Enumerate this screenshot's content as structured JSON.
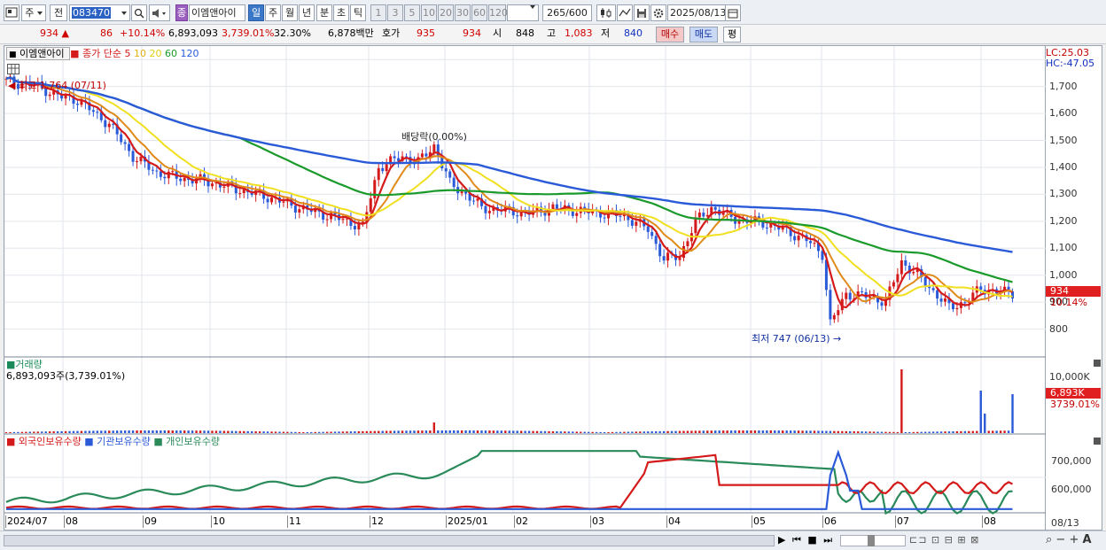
{
  "toolbar": {
    "period_label": "주",
    "prev_label": "전",
    "code": "083470",
    "badge": "종",
    "stock_name": "이엠앤아이",
    "periods": [
      "일",
      "주",
      "월",
      "년",
      "분",
      "초",
      "틱"
    ],
    "active_period": "일",
    "intervals": [
      "1",
      "3",
      "5",
      "10",
      "20",
      "30",
      "60",
      "120"
    ],
    "count": "265",
    "count_total": "/600",
    "date": "2025/08/13"
  },
  "quote": {
    "price": "934",
    "change": "86",
    "change_pct": "+10.14%",
    "volume": "6,893,093",
    "volume_pct": "3,739.01%",
    "turnover": "32.30%",
    "amount": "6,878백만",
    "hoga_label": "호가",
    "ask": "935",
    "bid": "934",
    "open_label": "시",
    "open": "848",
    "high_label": "고",
    "high": "1,083",
    "low_label": "저",
    "low": "840",
    "buy_label": "매수",
    "sell_label": "매도",
    "eval_label": "평"
  },
  "price_panel": {
    "stock_label": "이엠앤아이",
    "ma_label": "종가 단순",
    "ma_periods": [
      "5",
      "10",
      "20",
      "60",
      "120"
    ],
    "ma_colors": [
      "#d41a1a",
      "#e08a1a",
      "#f0e020",
      "#1a9a2a",
      "#2a5ad8"
    ],
    "lc_label": "LC:25.03",
    "hc_label": "HC:-47.05",
    "high_annot": "최고 1,764 (07/11)",
    "low_annot": "최저 747 (06/13)",
    "dividend_annot": "배당락(0.00%)",
    "last_price_tag": "934",
    "last_pct_tag": "10.14%"
  },
  "volume_panel": {
    "title": "거래량",
    "value_label": "6,893,093주(3,739.01%)",
    "axis_label": "10,000K",
    "last_tag": "6,893K",
    "last_pct_tag": "3739.01%"
  },
  "holdings_panel": {
    "legend": [
      {
        "label": "외국인보유수량",
        "color": "#d41a1a"
      },
      {
        "label": "기관보유수량",
        "color": "#2a5ad8"
      },
      {
        "label": "개인보유수량",
        "color": "#2a8a5a"
      }
    ],
    "axis_labels": [
      "700,000",
      "600,000"
    ]
  },
  "x_axis": {
    "labels": [
      "2024/07",
      "08",
      "09",
      "10",
      "11",
      "12",
      "2025/01",
      "02",
      "03",
      "04",
      "05",
      "06",
      "07",
      "08"
    ],
    "right_label": "08/13"
  },
  "chart_data": {
    "type": "line",
    "y_ticks": [
      800,
      900,
      1000,
      1100,
      1200,
      1300,
      1400,
      1500,
      1600,
      1700,
      1800
    ],
    "ylim": [
      700,
      1850
    ],
    "close_series_keypoints": [
      [
        0,
        1720
      ],
      [
        8,
        1700
      ],
      [
        14,
        1660
      ],
      [
        18,
        1650
      ],
      [
        26,
        1560
      ],
      [
        32,
        1440
      ],
      [
        38,
        1380
      ],
      [
        44,
        1360
      ],
      [
        50,
        1350
      ],
      [
        58,
        1320
      ],
      [
        66,
        1290
      ],
      [
        74,
        1250
      ],
      [
        84,
        1210
      ],
      [
        90,
        1180
      ],
      [
        94,
        1400
      ],
      [
        100,
        1440
      ],
      [
        104,
        1420
      ],
      [
        108,
        1480
      ],
      [
        112,
        1340
      ],
      [
        116,
        1300
      ],
      [
        120,
        1250
      ],
      [
        126,
        1240
      ],
      [
        132,
        1230
      ],
      [
        138,
        1250
      ],
      [
        144,
        1240
      ],
      [
        150,
        1230
      ],
      [
        156,
        1220
      ],
      [
        162,
        1170
      ],
      [
        166,
        1060
      ],
      [
        170,
        1070
      ],
      [
        174,
        1200
      ],
      [
        178,
        1250
      ],
      [
        182,
        1220
      ],
      [
        186,
        1200
      ],
      [
        190,
        1200
      ],
      [
        196,
        1170
      ],
      [
        202,
        1130
      ],
      [
        206,
        1080
      ],
      [
        208,
        820
      ],
      [
        212,
        930
      ],
      [
        218,
        920
      ],
      [
        222,
        900
      ],
      [
        226,
        1050
      ],
      [
        230,
        1000
      ],
      [
        234,
        940
      ],
      [
        238,
        880
      ],
      [
        242,
        900
      ],
      [
        246,
        950
      ],
      [
        250,
        940
      ],
      [
        254,
        934
      ]
    ]
  }
}
